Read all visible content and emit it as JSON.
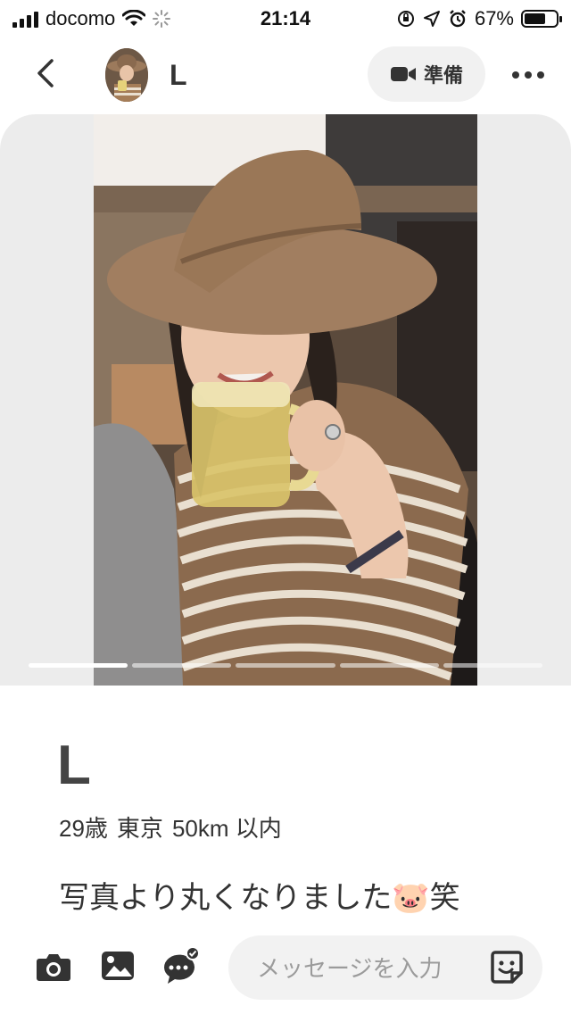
{
  "status_bar": {
    "carrier": "docomo",
    "time": "21:14",
    "battery": "67%",
    "battery_level": 0.67,
    "icons": [
      "signal-icon",
      "wifi-icon",
      "loading-icon",
      "orientation-lock-icon",
      "location-icon",
      "alarm-icon",
      "battery-icon"
    ]
  },
  "nav": {
    "name": "L",
    "video_button_label": "準備",
    "icons": [
      "back-chevron-icon",
      "video-camera-icon",
      "more-icon"
    ]
  },
  "photo": {
    "count": 5,
    "current": 1
  },
  "profile": {
    "name": "L",
    "age": "29歳",
    "location": "東京",
    "distance": "50km 以内",
    "bio": "写真より丸くなりました🐷笑"
  },
  "composer": {
    "placeholder": "メッセージを入力",
    "icons": [
      "camera-icon",
      "image-icon",
      "chat-check-icon",
      "sticker-icon"
    ]
  },
  "colors": {
    "accent_text": "#333333",
    "button_bg": "#f1f1f1",
    "input_bg": "#f2f2f2"
  }
}
